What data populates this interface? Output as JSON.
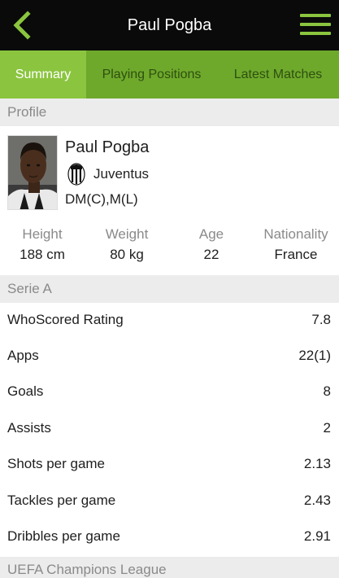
{
  "header": {
    "title": "Paul Pogba",
    "back_icon": "chevron-left-icon",
    "menu_icon": "hamburger-menu-icon",
    "accent_color": "#8bc53f"
  },
  "tabs": [
    {
      "label": "Summary",
      "active": true
    },
    {
      "label": "Playing Positions",
      "active": false
    },
    {
      "label": "Latest Matches",
      "active": false
    }
  ],
  "profile": {
    "section_title": "Profile",
    "name": "Paul Pogba",
    "club": "Juventus",
    "club_icon": "juventus-crest-icon",
    "positions": "DM(C),M(L)",
    "attributes": [
      {
        "label": "Height",
        "value": "188 cm"
      },
      {
        "label": "Weight",
        "value": "80 kg"
      },
      {
        "label": "Age",
        "value": "22"
      },
      {
        "label": "Nationality",
        "value": "France"
      }
    ]
  },
  "league": {
    "section_title": "Serie A",
    "stats": [
      {
        "label": "WhoScored Rating",
        "value": "7.8"
      },
      {
        "label": "Apps",
        "value": "22(1)"
      },
      {
        "label": "Goals",
        "value": "8"
      },
      {
        "label": "Assists",
        "value": "2"
      },
      {
        "label": "Shots per game",
        "value": "2.13"
      },
      {
        "label": "Tackles per game",
        "value": "2.43"
      },
      {
        "label": "Dribbles per game",
        "value": "2.91"
      }
    ]
  },
  "next_section": {
    "section_title": "UEFA Champions League"
  }
}
